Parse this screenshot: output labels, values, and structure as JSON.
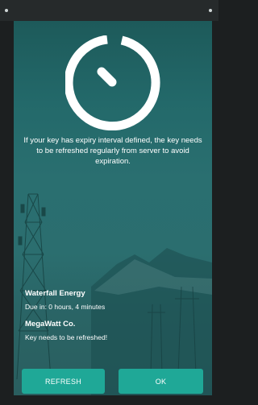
{
  "dialog": {
    "icon": "timer-icon",
    "message": "If your key has expiry interval defined, the key needs to be refreshed regularly from server to avoid expiration."
  },
  "keys": [
    {
      "name": "Waterfall Energy",
      "status": "Due in: 0 hours, 4 minutes"
    },
    {
      "name": "MegaWatt Co.",
      "status": "Key needs to be refreshed!"
    }
  ],
  "buttons": {
    "refresh_label": "REFRESH",
    "ok_label": "OK"
  },
  "colors": {
    "dialog_tint": "#2b6e6f",
    "button": "#1fa897",
    "text": "#ffffff"
  }
}
